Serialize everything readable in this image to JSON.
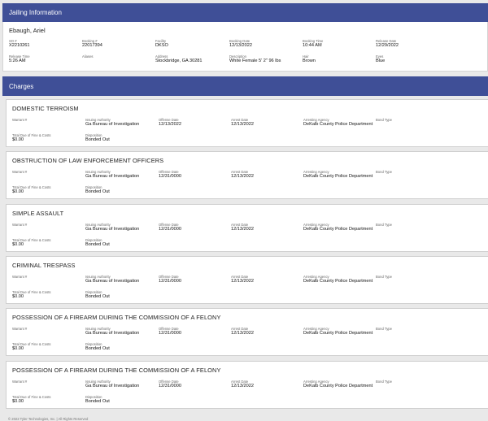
{
  "jailing": {
    "header": "Jailing Information",
    "name": "Ebaugh, Ariel",
    "fields": [
      {
        "label": "SO #",
        "value": "X2210261"
      },
      {
        "label": "Booking #",
        "value": "22017394"
      },
      {
        "label": "Facility",
        "value": "DKSO"
      },
      {
        "label": "Booking Date",
        "value": "12/13/2022"
      },
      {
        "label": "Booking Time",
        "value": "10:44 AM"
      },
      {
        "label": "Release Date",
        "value": "12/29/2022"
      },
      {
        "label": "Release Time",
        "value": "5:26 AM"
      },
      {
        "label": "Aliases",
        "value": ""
      },
      {
        "label": "Address",
        "value": "Stockbridge, GA 30281"
      },
      {
        "label": "Description",
        "value": "White Female 5' 2\" 96 lbs"
      },
      {
        "label": "Hair",
        "value": "Brown"
      },
      {
        "label": "Eyes",
        "value": "Blue"
      }
    ]
  },
  "charges": {
    "header": "Charges",
    "labels": {
      "warrant": "Warrant #",
      "authority": "Issuing Authority",
      "offense_date": "Offense Date",
      "arrest_date": "Arrest Date",
      "agency": "Arresting Agency",
      "bond_type": "Bond Type",
      "total_due": "Total Due of Fine & Costs",
      "disposition": "Disposition"
    },
    "items": [
      {
        "title": "DOMESTIC TERROISM",
        "warrant": "",
        "authority": "Ga Bureau of Investigation",
        "offense_date": "12/13/2022",
        "arrest_date": "12/13/2022",
        "agency": "DeKalb County Police Department",
        "bond_type": "",
        "total_due": "$0.00",
        "disposition": "Bonded Out"
      },
      {
        "title": "OBSTRUCTION OF LAW ENFORCEMENT OFFICERS",
        "warrant": "",
        "authority": "Ga Bureau of Investigation",
        "offense_date": "12/31/0000",
        "arrest_date": "12/13/2022",
        "agency": "DeKalb County Police Department",
        "bond_type": "",
        "total_due": "$0.00",
        "disposition": "Bonded Out"
      },
      {
        "title": "SIMPLE ASSAULT",
        "warrant": "",
        "authority": "Ga Bureau of Investigation",
        "offense_date": "12/31/0000",
        "arrest_date": "12/13/2022",
        "agency": "DeKalb County Police Department",
        "bond_type": "",
        "total_due": "$0.00",
        "disposition": "Bonded Out"
      },
      {
        "title": "CRIMINAL TRESPASS",
        "warrant": "",
        "authority": "Ga Bureau of Investigation",
        "offense_date": "12/31/0000",
        "arrest_date": "12/13/2022",
        "agency": "DeKalb County Police Department",
        "bond_type": "",
        "total_due": "$0.00",
        "disposition": "Bonded Out"
      },
      {
        "title": "POSSESSION OF A FIREARM DURING THE COMMISSION OF A FELONY",
        "warrant": "",
        "authority": "Ga Bureau of Investigation",
        "offense_date": "12/31/0000",
        "arrest_date": "12/13/2022",
        "agency": "DeKalb County Police Department",
        "bond_type": "",
        "total_due": "$0.00",
        "disposition": "Bonded Out"
      },
      {
        "title": "POSSESSION OF A FIREARM DURING THE COMMISSION OF A FELONY",
        "warrant": "",
        "authority": "Ga Bureau of Investigation",
        "offense_date": "12/31/0000",
        "arrest_date": "12/13/2022",
        "agency": "DeKalb County Police Department",
        "bond_type": "",
        "total_due": "$0.00",
        "disposition": "Bonded Out"
      }
    ]
  },
  "footer": "© 2022 Tyler Technologies, Inc. | All Rights Reserved"
}
